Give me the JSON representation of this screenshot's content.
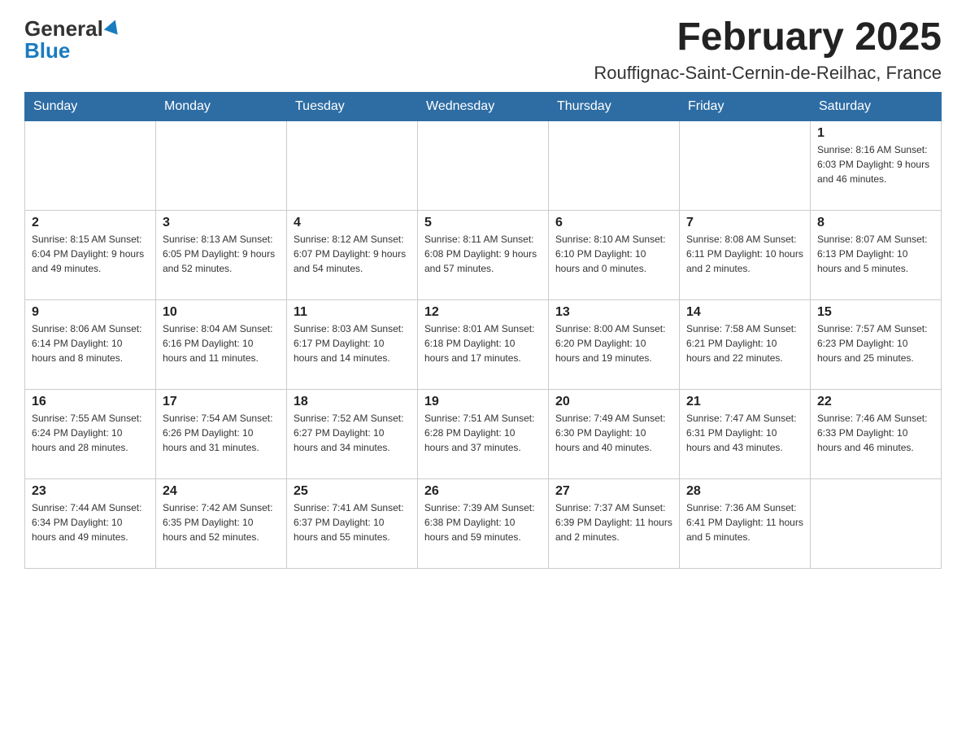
{
  "header": {
    "logo_general": "General",
    "logo_blue": "Blue",
    "month_title": "February 2025",
    "location": "Rouffignac-Saint-Cernin-de-Reilhac, France"
  },
  "weekdays": [
    "Sunday",
    "Monday",
    "Tuesday",
    "Wednesday",
    "Thursday",
    "Friday",
    "Saturday"
  ],
  "weeks": [
    [
      {
        "day": "",
        "info": ""
      },
      {
        "day": "",
        "info": ""
      },
      {
        "day": "",
        "info": ""
      },
      {
        "day": "",
        "info": ""
      },
      {
        "day": "",
        "info": ""
      },
      {
        "day": "",
        "info": ""
      },
      {
        "day": "1",
        "info": "Sunrise: 8:16 AM\nSunset: 6:03 PM\nDaylight: 9 hours and 46 minutes."
      }
    ],
    [
      {
        "day": "2",
        "info": "Sunrise: 8:15 AM\nSunset: 6:04 PM\nDaylight: 9 hours and 49 minutes."
      },
      {
        "day": "3",
        "info": "Sunrise: 8:13 AM\nSunset: 6:05 PM\nDaylight: 9 hours and 52 minutes."
      },
      {
        "day": "4",
        "info": "Sunrise: 8:12 AM\nSunset: 6:07 PM\nDaylight: 9 hours and 54 minutes."
      },
      {
        "day": "5",
        "info": "Sunrise: 8:11 AM\nSunset: 6:08 PM\nDaylight: 9 hours and 57 minutes."
      },
      {
        "day": "6",
        "info": "Sunrise: 8:10 AM\nSunset: 6:10 PM\nDaylight: 10 hours and 0 minutes."
      },
      {
        "day": "7",
        "info": "Sunrise: 8:08 AM\nSunset: 6:11 PM\nDaylight: 10 hours and 2 minutes."
      },
      {
        "day": "8",
        "info": "Sunrise: 8:07 AM\nSunset: 6:13 PM\nDaylight: 10 hours and 5 minutes."
      }
    ],
    [
      {
        "day": "9",
        "info": "Sunrise: 8:06 AM\nSunset: 6:14 PM\nDaylight: 10 hours and 8 minutes."
      },
      {
        "day": "10",
        "info": "Sunrise: 8:04 AM\nSunset: 6:16 PM\nDaylight: 10 hours and 11 minutes."
      },
      {
        "day": "11",
        "info": "Sunrise: 8:03 AM\nSunset: 6:17 PM\nDaylight: 10 hours and 14 minutes."
      },
      {
        "day": "12",
        "info": "Sunrise: 8:01 AM\nSunset: 6:18 PM\nDaylight: 10 hours and 17 minutes."
      },
      {
        "day": "13",
        "info": "Sunrise: 8:00 AM\nSunset: 6:20 PM\nDaylight: 10 hours and 19 minutes."
      },
      {
        "day": "14",
        "info": "Sunrise: 7:58 AM\nSunset: 6:21 PM\nDaylight: 10 hours and 22 minutes."
      },
      {
        "day": "15",
        "info": "Sunrise: 7:57 AM\nSunset: 6:23 PM\nDaylight: 10 hours and 25 minutes."
      }
    ],
    [
      {
        "day": "16",
        "info": "Sunrise: 7:55 AM\nSunset: 6:24 PM\nDaylight: 10 hours and 28 minutes."
      },
      {
        "day": "17",
        "info": "Sunrise: 7:54 AM\nSunset: 6:26 PM\nDaylight: 10 hours and 31 minutes."
      },
      {
        "day": "18",
        "info": "Sunrise: 7:52 AM\nSunset: 6:27 PM\nDaylight: 10 hours and 34 minutes."
      },
      {
        "day": "19",
        "info": "Sunrise: 7:51 AM\nSunset: 6:28 PM\nDaylight: 10 hours and 37 minutes."
      },
      {
        "day": "20",
        "info": "Sunrise: 7:49 AM\nSunset: 6:30 PM\nDaylight: 10 hours and 40 minutes."
      },
      {
        "day": "21",
        "info": "Sunrise: 7:47 AM\nSunset: 6:31 PM\nDaylight: 10 hours and 43 minutes."
      },
      {
        "day": "22",
        "info": "Sunrise: 7:46 AM\nSunset: 6:33 PM\nDaylight: 10 hours and 46 minutes."
      }
    ],
    [
      {
        "day": "23",
        "info": "Sunrise: 7:44 AM\nSunset: 6:34 PM\nDaylight: 10 hours and 49 minutes."
      },
      {
        "day": "24",
        "info": "Sunrise: 7:42 AM\nSunset: 6:35 PM\nDaylight: 10 hours and 52 minutes."
      },
      {
        "day": "25",
        "info": "Sunrise: 7:41 AM\nSunset: 6:37 PM\nDaylight: 10 hours and 55 minutes."
      },
      {
        "day": "26",
        "info": "Sunrise: 7:39 AM\nSunset: 6:38 PM\nDaylight: 10 hours and 59 minutes."
      },
      {
        "day": "27",
        "info": "Sunrise: 7:37 AM\nSunset: 6:39 PM\nDaylight: 11 hours and 2 minutes."
      },
      {
        "day": "28",
        "info": "Sunrise: 7:36 AM\nSunset: 6:41 PM\nDaylight: 11 hours and 5 minutes."
      },
      {
        "day": "",
        "info": ""
      }
    ]
  ]
}
